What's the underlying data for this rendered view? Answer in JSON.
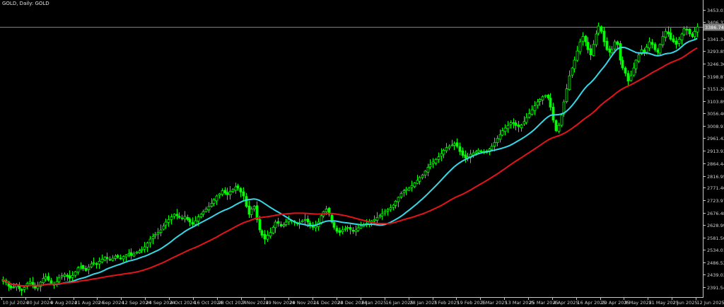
{
  "window": {
    "title": "GOLD, Daily:  GOLD"
  },
  "chart_data": {
    "type": "candlestick",
    "symbol": "GOLD",
    "timeframe": "Daily",
    "title": "GOLD, Daily:  GOLD",
    "grid": false,
    "colors": {
      "background": "#000000",
      "bull": "#00ff00",
      "bear": "#00ff00",
      "ma_fast": "#37d7e6",
      "ma_slow": "#e2141b",
      "axis_text": "#cfcfcf",
      "current_price_line": "#7f7f7f",
      "current_price_label_bg": "#7f7f7f"
    },
    "y_axis": {
      "ylim": [
        2353.0,
        3490.0
      ],
      "tick_labels": [
        "3453.01",
        "3406.32",
        "3341.34",
        "3293.85",
        "3246.36",
        "3198.87",
        "3151.28",
        "3103.89",
        "3056.40",
        "3008.91",
        "2961.42",
        "2913.93",
        "2864.44",
        "2816.95",
        "2771.46",
        "2723.97",
        "2676.48",
        "2628.99",
        "2581.50",
        "2534.01",
        "2486.52",
        "2439.03",
        "2391.54"
      ]
    },
    "x_axis": {
      "tick_labels": [
        "10 Jul 2024",
        "30 Jul 2024",
        "9 Aug 2024",
        "21 Aug 2024",
        "2 Sep 2024",
        "12 Sep 2024",
        "24 Sep 2024",
        "4 Oct 2024",
        "16 Oct 2024",
        "28 Oct 2024",
        "7 Nov 2024",
        "19 Nov 2024",
        "29 Nov 2024",
        "11 Dec 2024",
        "23 Dec 2024",
        "6 Jan 2025",
        "16 Jan 2025",
        "28 Jan 2025",
        "7 Feb 2025",
        "19 Feb 2025",
        "3 Mar 2025",
        "13 Mar 2025",
        "25 Mar 2025",
        "4 Apr 2025",
        "16 Apr 2025",
        "29 Apr 2025",
        "9 May 2025",
        "21 May 2025",
        "2 Jun 2025",
        "12 Jun 2025"
      ]
    },
    "current_price": 3386.74,
    "closes": [
      2420,
      2410,
      2395,
      2388,
      2392,
      2400,
      2385,
      2378,
      2390,
      2405,
      2412,
      2398,
      2388,
      2395,
      2410,
      2425,
      2430,
      2418,
      2405,
      2400,
      2412,
      2428,
      2435,
      2440,
      2432,
      2425,
      2436,
      2450,
      2465,
      2470,
      2462,
      2455,
      2468,
      2480,
      2485,
      2478,
      2490,
      2498,
      2505,
      2500,
      2495,
      2502,
      2510,
      2506,
      2500,
      2508,
      2515,
      2520,
      2512,
      2518,
      2525,
      2530,
      2536,
      2545,
      2560,
      2575,
      2585,
      2592,
      2600,
      2610,
      2625,
      2640,
      2650,
      2660,
      2670,
      2665,
      2658,
      2655,
      2662,
      2650,
      2640,
      2632,
      2645,
      2660,
      2670,
      2680,
      2690,
      2700,
      2712,
      2725,
      2740,
      2748,
      2760,
      2752,
      2745,
      2758,
      2765,
      2775,
      2770,
      2755,
      2740,
      2700,
      2670,
      2690,
      2700,
      2650,
      2610,
      2590,
      2575,
      2590,
      2600,
      2620,
      2640,
      2635,
      2625,
      2630,
      2640,
      2650,
      2645,
      2640,
      2635,
      2638,
      2645,
      2650,
      2640,
      2630,
      2620,
      2625,
      2640,
      2665,
      2680,
      2690,
      2670,
      2640,
      2620,
      2605,
      2600,
      2610,
      2615,
      2620,
      2612,
      2605,
      2610,
      2618,
      2625,
      2630,
      2635,
      2640,
      2645,
      2650,
      2658,
      2665,
      2672,
      2680,
      2688,
      2695,
      2705,
      2720,
      2735,
      2750,
      2760,
      2765,
      2770,
      2780,
      2790,
      2800,
      2810,
      2820,
      2835,
      2850,
      2860,
      2870,
      2880,
      2890,
      2902,
      2915,
      2925,
      2930,
      2935,
      2940,
      2930,
      2910,
      2895,
      2885,
      2890,
      2900,
      2905,
      2910,
      2915,
      2910,
      2905,
      2912,
      2920,
      2930,
      2945,
      2960,
      2975,
      2990,
      3000,
      3010,
      3020,
      3018,
      3010,
      3005,
      3012,
      3025,
      3040,
      3055,
      3070,
      3085,
      3100,
      3110,
      3120,
      3125,
      3115,
      3080,
      3030,
      2990,
      3010,
      3050,
      3100,
      3150,
      3200,
      3230,
      3260,
      3295,
      3330,
      3350,
      3330,
      3300,
      3280,
      3320,
      3360,
      3390,
      3370,
      3330,
      3300,
      3290,
      3300,
      3330,
      3320,
      3260,
      3230,
      3210,
      3180,
      3200,
      3230,
      3260,
      3280,
      3300,
      3290,
      3310,
      3330,
      3320,
      3300,
      3290,
      3320,
      3350,
      3370,
      3360,
      3340,
      3330,
      3320,
      3340,
      3360,
      3380,
      3375,
      3360,
      3350,
      3370,
      3386.74
    ]
  }
}
